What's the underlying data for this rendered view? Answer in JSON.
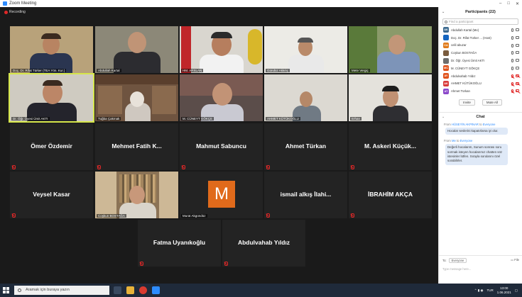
{
  "window": {
    "title": "Zoom Meeting",
    "controls": [
      "–",
      "□",
      "✕"
    ]
  },
  "recording": {
    "label": "Recording"
  },
  "video_tiles": [
    {
      "name": "Doç. Dr. Rifat Türker (TEA Yön. Kur.)",
      "muted": false,
      "video": true
    },
    {
      "name": "Abdullah Kartal",
      "muted": false,
      "video": true
    },
    {
      "name": "HM. ARSLAN",
      "muted": false,
      "video": true
    },
    {
      "name": "Gündüz Akkılıç",
      "muted": false,
      "video": true
    },
    {
      "name": "Mete Vergiç",
      "muted": false,
      "video": true
    },
    {
      "name": "Dr. Öğr. Üyesi Ümit AKTI",
      "muted": false,
      "video": true,
      "active": true
    },
    {
      "name": "Tuğba Çakmak",
      "muted": false,
      "video": true
    },
    {
      "name": "M. CÜNEYT GÖKÇE",
      "muted": false,
      "video": true
    },
    {
      "name": "AHMET KÜTÜKOĞLU",
      "muted": false,
      "video": true
    },
    {
      "name": "Erhan",
      "muted": false,
      "video": true
    },
    {
      "name": "Ömer Özdemir",
      "muted": true,
      "video": false
    },
    {
      "name": "Mehmet Fatih K...",
      "muted": true,
      "video": false
    },
    {
      "name": "Mahmut Sabuncu",
      "muted": true,
      "video": false
    },
    {
      "name": "Ahmet Türkan",
      "muted": true,
      "video": false
    },
    {
      "name": "M. Askeri Küçük...",
      "muted": true,
      "video": false
    },
    {
      "name": "Veysel Kasar",
      "muted": true,
      "video": false
    },
    {
      "name": "Coşkun BOSTAĞA",
      "muted": true,
      "video": true
    },
    {
      "name": "Murat Akgündüz",
      "muted": true,
      "video": false,
      "avatar_letter": "M"
    },
    {
      "name": "ismail alkış İlahi...",
      "muted": true,
      "video": false
    },
    {
      "name": "İBRAHİM AKÇA",
      "muted": true,
      "video": false
    },
    {
      "name": "Fatma Uyanıkoğlu",
      "muted": true,
      "video": false
    },
    {
      "name": "Abdulvahab Yıldız",
      "muted": true,
      "video": false
    }
  ],
  "participants": {
    "header": "Participants (22)",
    "search_placeholder": "Find a participant",
    "list": [
      {
        "initials": "AK",
        "name": "Abdullah Kartal (Me)",
        "color": "#3d6a8f",
        "mic_muted": false,
        "cam_muted": false
      },
      {
        "initials": "",
        "name": "Doç. Dr. Rifat Türker ... (Host)",
        "color": "#1565c0",
        "mic_muted": false,
        "cam_muted": false
      },
      {
        "initials": "CA",
        "name": "celil abuzar",
        "color": "#e07b1b",
        "mic_muted": false,
        "cam_muted": false
      },
      {
        "initials": "",
        "name": "Coşkun BOSTAĞA",
        "color": "#7a5c3e",
        "mic_muted": false,
        "cam_muted": false
      },
      {
        "initials": "",
        "name": "Dr. Öğr. Üyesi Ümit AKTI",
        "color": "#6d6d6d",
        "mic_muted": false,
        "cam_muted": false
      },
      {
        "initials": "MC",
        "name": "M. CÜNEYT GÖKÇE",
        "color": "#e0521b",
        "mic_muted": false,
        "cam_muted": false
      },
      {
        "initials": "AY",
        "name": "Abdulvahab Yıldız",
        "color": "#e0521b",
        "mic_muted": true,
        "cam_muted": true
      },
      {
        "initials": "AK",
        "name": "AHMET KÜTÜKOĞLU",
        "color": "#d83a3a",
        "mic_muted": true,
        "cam_muted": true
      },
      {
        "initials": "AT",
        "name": "Ahmet Türkan",
        "color": "#8a47c9",
        "mic_muted": true,
        "cam_muted": true
      }
    ],
    "invite_label": "Invite",
    "mute_all_label": "Mute All"
  },
  "chat": {
    "header": "Chat",
    "messages": [
      {
        "from_label": "From",
        "sender": "HÜSEYİN AKPINAR",
        "to_label": "to",
        "recipient": "Everyone",
        "text": "Hocalar seslerini kapatırlarsa iyi olur."
      },
      {
        "from_label": "From",
        "sender": "Me",
        "to_label": "to",
        "recipient": "Everyone",
        "text": "Değerli hocalarım, Sunum sonrası soru sormak isteyen hocalarımız chatten söz istesinler lütfen. Sırayla sorularını özel sorabilirler."
      }
    ],
    "to_label": "To:",
    "to_value": "Everyone",
    "file_label": "File",
    "input_placeholder": "Type message here..."
  },
  "taskbar": {
    "search_placeholder": "Aramak için buraya yazın",
    "lang": "TUR",
    "time": "13:00",
    "date": "1.06.2021"
  }
}
